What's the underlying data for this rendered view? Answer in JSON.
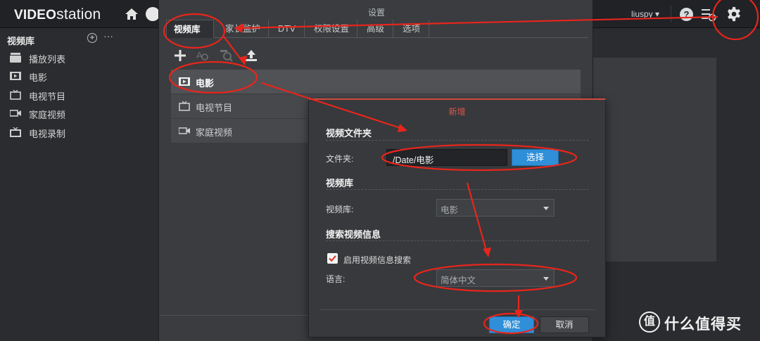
{
  "topbar": {
    "logo_video": "VIDEO",
    "logo_station": "station",
    "username": "liuspy ▾"
  },
  "sidebar": {
    "title": "视频库",
    "add_label": "+",
    "more_label": "···",
    "items": [
      {
        "label": "播放列表",
        "icon": "playlist-icon"
      },
      {
        "label": "电影",
        "icon": "movie-icon"
      },
      {
        "label": "电视节目",
        "icon": "tv-icon"
      },
      {
        "label": "家庭视频",
        "icon": "camera-icon"
      },
      {
        "label": "电视录制",
        "icon": "tv-record-icon"
      }
    ]
  },
  "settings": {
    "title": "设置",
    "tabs": [
      "视频库",
      "家长监护",
      "DTV",
      "权限设置",
      "高级",
      "选项"
    ],
    "active_tab": "视频库",
    "libraries": [
      {
        "label": "电影",
        "selected": true
      },
      {
        "label": "电视节目",
        "selected": false
      },
      {
        "label": "家庭视频",
        "selected": false
      }
    ]
  },
  "add_dialog": {
    "title": "新增",
    "section_folder": "视频文件夹",
    "folder_label": "文件夹:",
    "folder_value": "/Date/电影",
    "choose_label": "选择",
    "section_library": "视频库",
    "library_label": "视频库:",
    "library_value": "电影",
    "section_search": "搜索视频信息",
    "enable_search_label": "启用视频信息搜索",
    "enable_search_checked": true,
    "language_label": "语言:",
    "language_value": "简体中文",
    "ok_label": "确定",
    "cancel_label": "取消"
  },
  "watermark": {
    "logo_char": "值",
    "text": "什么值得买"
  },
  "colors": {
    "accent_blue": "#2f8fd8",
    "annotation_red": "#e8251c",
    "dialog_title_red": "#e0554a"
  }
}
